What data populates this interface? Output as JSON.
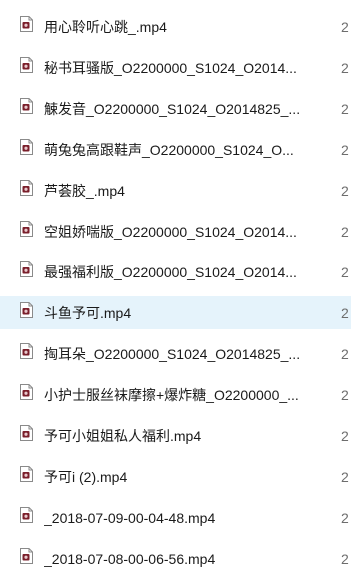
{
  "file_icon": "video-file-icon",
  "accent_colors": {
    "selected_row_bg": "#e5f3fb",
    "file_icon_badge": "#7a1f2b"
  },
  "files": [
    {
      "name": "用心聆听心跳_.mp4",
      "date": "2",
      "selected": false
    },
    {
      "name": "秘书耳骚版_O2200000_S1024_O2014...",
      "date": "2",
      "selected": false
    },
    {
      "name": "觫发音_O2200000_S1024_O2014825_...",
      "date": "2",
      "selected": false
    },
    {
      "name": "萌兔兔高跟鞋声_O2200000_S1024_O...",
      "date": "2",
      "selected": false
    },
    {
      "name": "芦荟胶_.mp4",
      "date": "2",
      "selected": false
    },
    {
      "name": "空姐娇喘版_O2200000_S1024_O2014...",
      "date": "2",
      "selected": false
    },
    {
      "name": "最强福利版_O2200000_S1024_O2014...",
      "date": "2",
      "selected": false
    },
    {
      "name": "斗鱼予可.mp4",
      "date": "2",
      "selected": true
    },
    {
      "name": "掏耳朵_O2200000_S1024_O2014825_...",
      "date": "2",
      "selected": false
    },
    {
      "name": "小护士服丝袜摩擦+爆炸糖_O2200000_...",
      "date": "2",
      "selected": false
    },
    {
      "name": "予可小姐姐私人福利.mp4",
      "date": "2",
      "selected": false
    },
    {
      "name": "予可i (2).mp4",
      "date": "2",
      "selected": false
    },
    {
      "name": "_2018-07-09-00-04-48.mp4",
      "date": "2",
      "selected": false
    },
    {
      "name": "_2018-07-08-00-06-56.mp4",
      "date": "2",
      "selected": false
    }
  ]
}
